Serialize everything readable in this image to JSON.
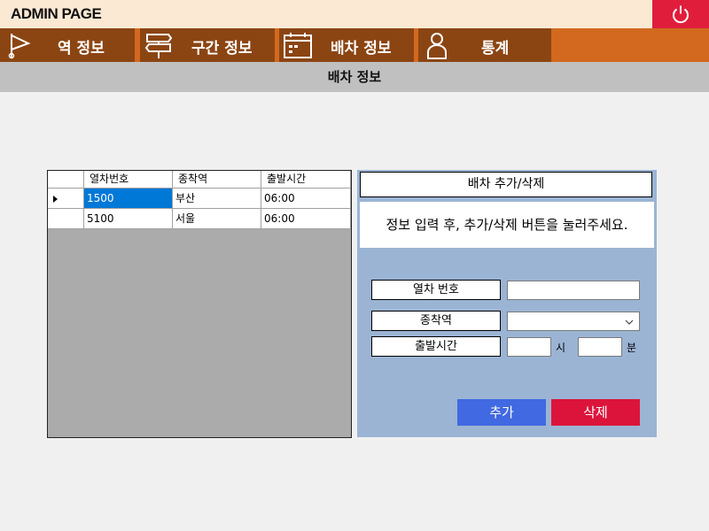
{
  "app": {
    "title": "ADMIN PAGE"
  },
  "nav": {
    "items": [
      {
        "label": "역 정보",
        "icon": "flag-icon"
      },
      {
        "label": "구간 정보",
        "icon": "signpost-icon"
      },
      {
        "label": "배차 정보",
        "icon": "calendar-icon"
      },
      {
        "label": "통계",
        "icon": "person-icon"
      }
    ]
  },
  "subheader": {
    "title": "배차 정보"
  },
  "grid": {
    "columns": [
      "열차번호",
      "종착역",
      "출발시간"
    ],
    "rows": [
      [
        "1500",
        "부산",
        "06:00"
      ],
      [
        "5100",
        "서울",
        "06:00"
      ]
    ]
  },
  "panel": {
    "title": "배차 추가/삭제",
    "message": "정보 입력 후, 추가/삭제 버튼을 눌러주세요.",
    "fields": {
      "train_no_label": "열차 번호",
      "destination_label": "종착역",
      "depart_label": "출발시간",
      "hour_unit": "시",
      "minute_unit": "분",
      "train_no_value": "",
      "destination_value": "",
      "hour_value": "",
      "minute_value": ""
    },
    "add_label": "추가",
    "delete_label": "삭제"
  },
  "colors": {
    "nav_bg": "#d2691e",
    "nav_item": "#8b4513",
    "power": "#e01e3c",
    "add": "#4169e1",
    "delete": "#dc143c",
    "selection": "#0078d7",
    "panel_bg": "#9bb4d4"
  }
}
